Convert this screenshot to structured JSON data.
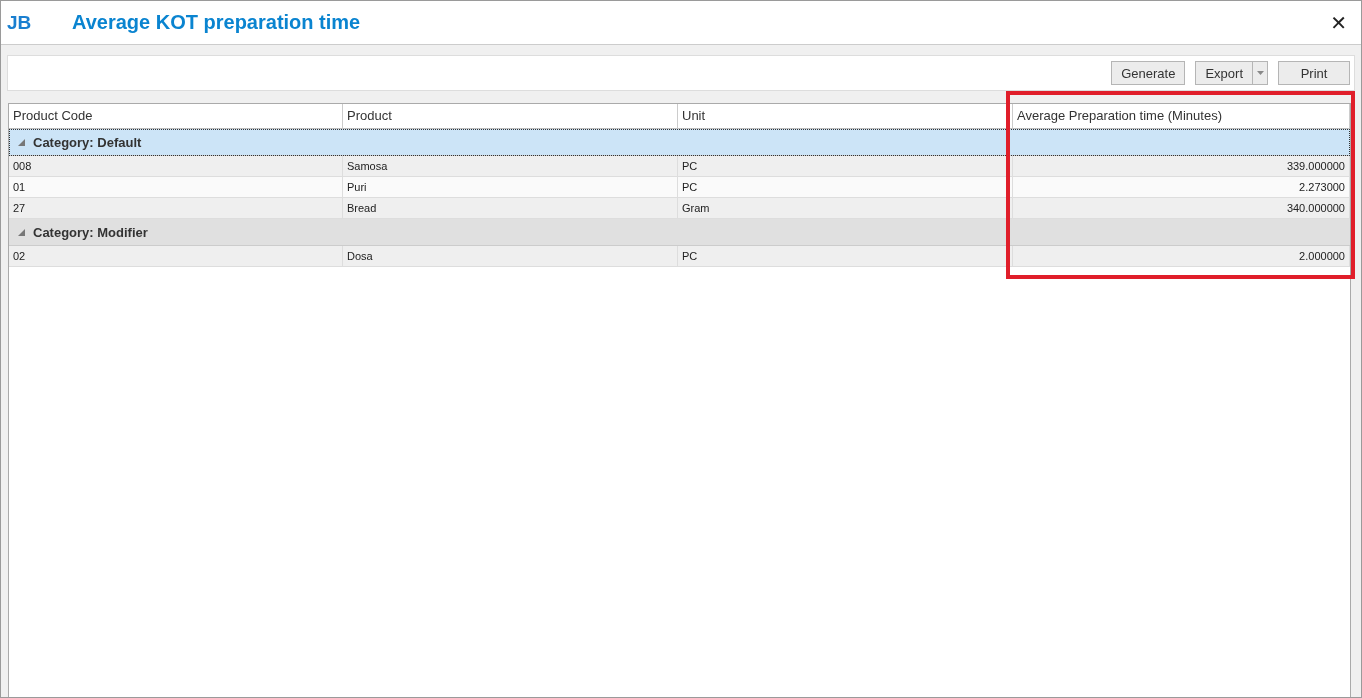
{
  "window": {
    "logo": "JB",
    "title": "Average KOT preparation time",
    "close": "✕"
  },
  "toolbar": {
    "buttons": [
      {
        "kind": "plain",
        "label": "Generate"
      },
      {
        "kind": "split",
        "label": "Export"
      },
      {
        "kind": "plain",
        "label": "Print"
      }
    ]
  },
  "table": {
    "columns": [
      "Product Code",
      "Product",
      "Unit",
      "Average Preparation time (Minutes)"
    ],
    "groups": [
      {
        "label": "Category: Default",
        "selected": true,
        "expanded": true,
        "rows": [
          [
            "008",
            "Samosa",
            "PC",
            "339.000000"
          ],
          [
            "01",
            "Puri",
            "PC",
            "2.273000"
          ],
          [
            "27",
            "Bread",
            "Gram",
            "340.000000"
          ]
        ]
      },
      {
        "label": "Category: Modifier",
        "selected": false,
        "expanded": true,
        "rows": [
          [
            "02",
            "Dosa",
            "PC",
            "2.000000"
          ]
        ]
      }
    ]
  }
}
